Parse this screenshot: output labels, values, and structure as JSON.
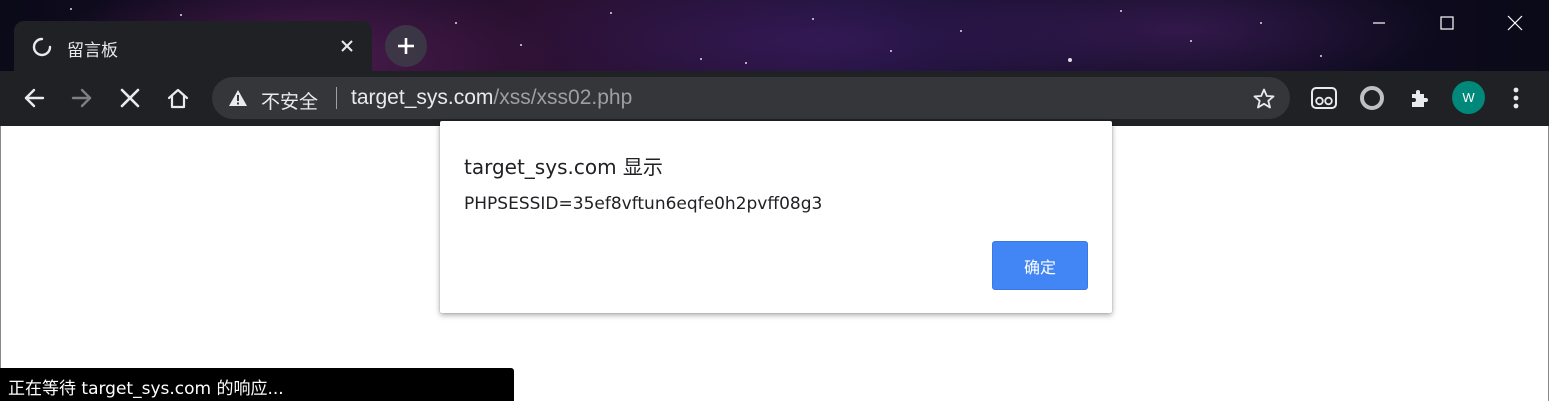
{
  "browser": {
    "tab": {
      "title": "留言板"
    },
    "omnibox": {
      "security_label": "不安全",
      "url_host": "target_sys.com",
      "url_path": "/xss/xss02.php"
    },
    "profile_initial": "W",
    "colors": {
      "frame": "#202124",
      "omnibox": "#35363a",
      "avatar": "#00897b"
    }
  },
  "dialog": {
    "title": "target_sys.com 显示",
    "message": "PHPSESSID=35ef8vftun6eqfe0h2pvff08g3",
    "ok_label": "确定",
    "colors": {
      "ok_button": "#4285f4"
    }
  },
  "status_bar": {
    "text": "正在等待 target_sys.com 的响应..."
  }
}
